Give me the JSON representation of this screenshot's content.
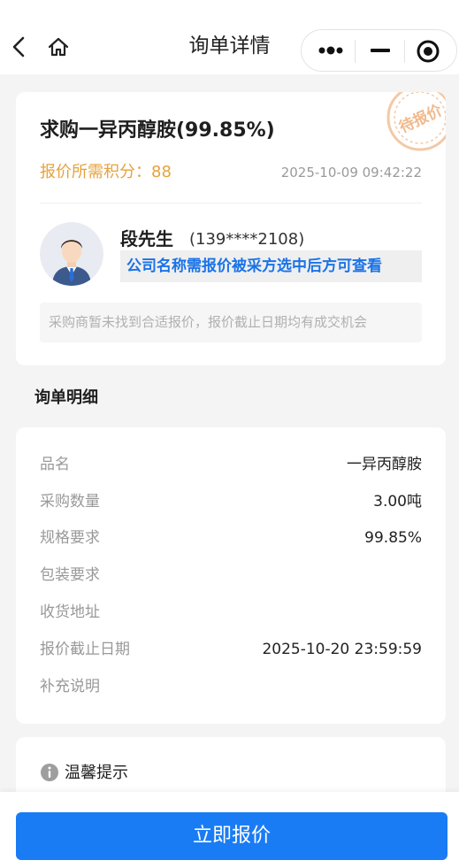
{
  "nav": {
    "title": "询单详情"
  },
  "inquiry": {
    "title": "求购一异丙醇胺(99.85%)",
    "points_label": "报价所需积分：88",
    "time": "2025-10-09 09:42:22",
    "stamp_text": "待报价"
  },
  "buyer": {
    "name": "段先生",
    "phone": "(139****2108)",
    "company_note": "公司名称需报价被采方选中后方可查看"
  },
  "notice": "采购商暂未找到合适报价，报价截止日期均有成交机会",
  "details": {
    "section_title": "询单明细",
    "rows": [
      {
        "label": "品名",
        "value": "一异丙醇胺"
      },
      {
        "label": "采购数量",
        "value": "3.00吨"
      },
      {
        "label": "规格要求",
        "value": "99.85%"
      },
      {
        "label": "包装要求",
        "value": ""
      },
      {
        "label": "收货地址",
        "value": ""
      },
      {
        "label": "报价截止日期",
        "value": "2025-10-20 23:59:59"
      },
      {
        "label": "补充说明",
        "value": ""
      }
    ]
  },
  "warm_tip": {
    "title": "温馨提示"
  },
  "action": {
    "quote_label": "立即报价"
  },
  "colors": {
    "accent": "#1a7cf5",
    "points": "#e6a23c",
    "company_note": "#1a73e8"
  }
}
